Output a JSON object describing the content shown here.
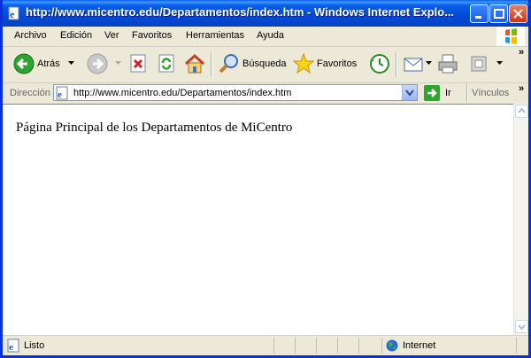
{
  "window": {
    "title": "http://www.micentro.edu/Departamentos/index.htm - Windows Internet Explo..."
  },
  "menu": {
    "items": [
      "Archivo",
      "Edición",
      "Ver",
      "Favoritos",
      "Herramientas",
      "Ayuda"
    ]
  },
  "toolbar": {
    "back_label": "Atrás",
    "search_label": "Búsqueda",
    "favorites_label": "Favoritos"
  },
  "address": {
    "label": "Dirección",
    "url": "http://www.micentro.edu/Departamentos/index.htm",
    "go_label": "Ir",
    "links_label": "Vínculos"
  },
  "page": {
    "heading": "Página Principal de los Departamentos de MiCentro"
  },
  "status": {
    "text": "Listo",
    "zone": "Internet"
  },
  "colors": {
    "titlebar": "#0a5fe8",
    "chrome": "#ece9d8",
    "frame": "#0831d9"
  }
}
